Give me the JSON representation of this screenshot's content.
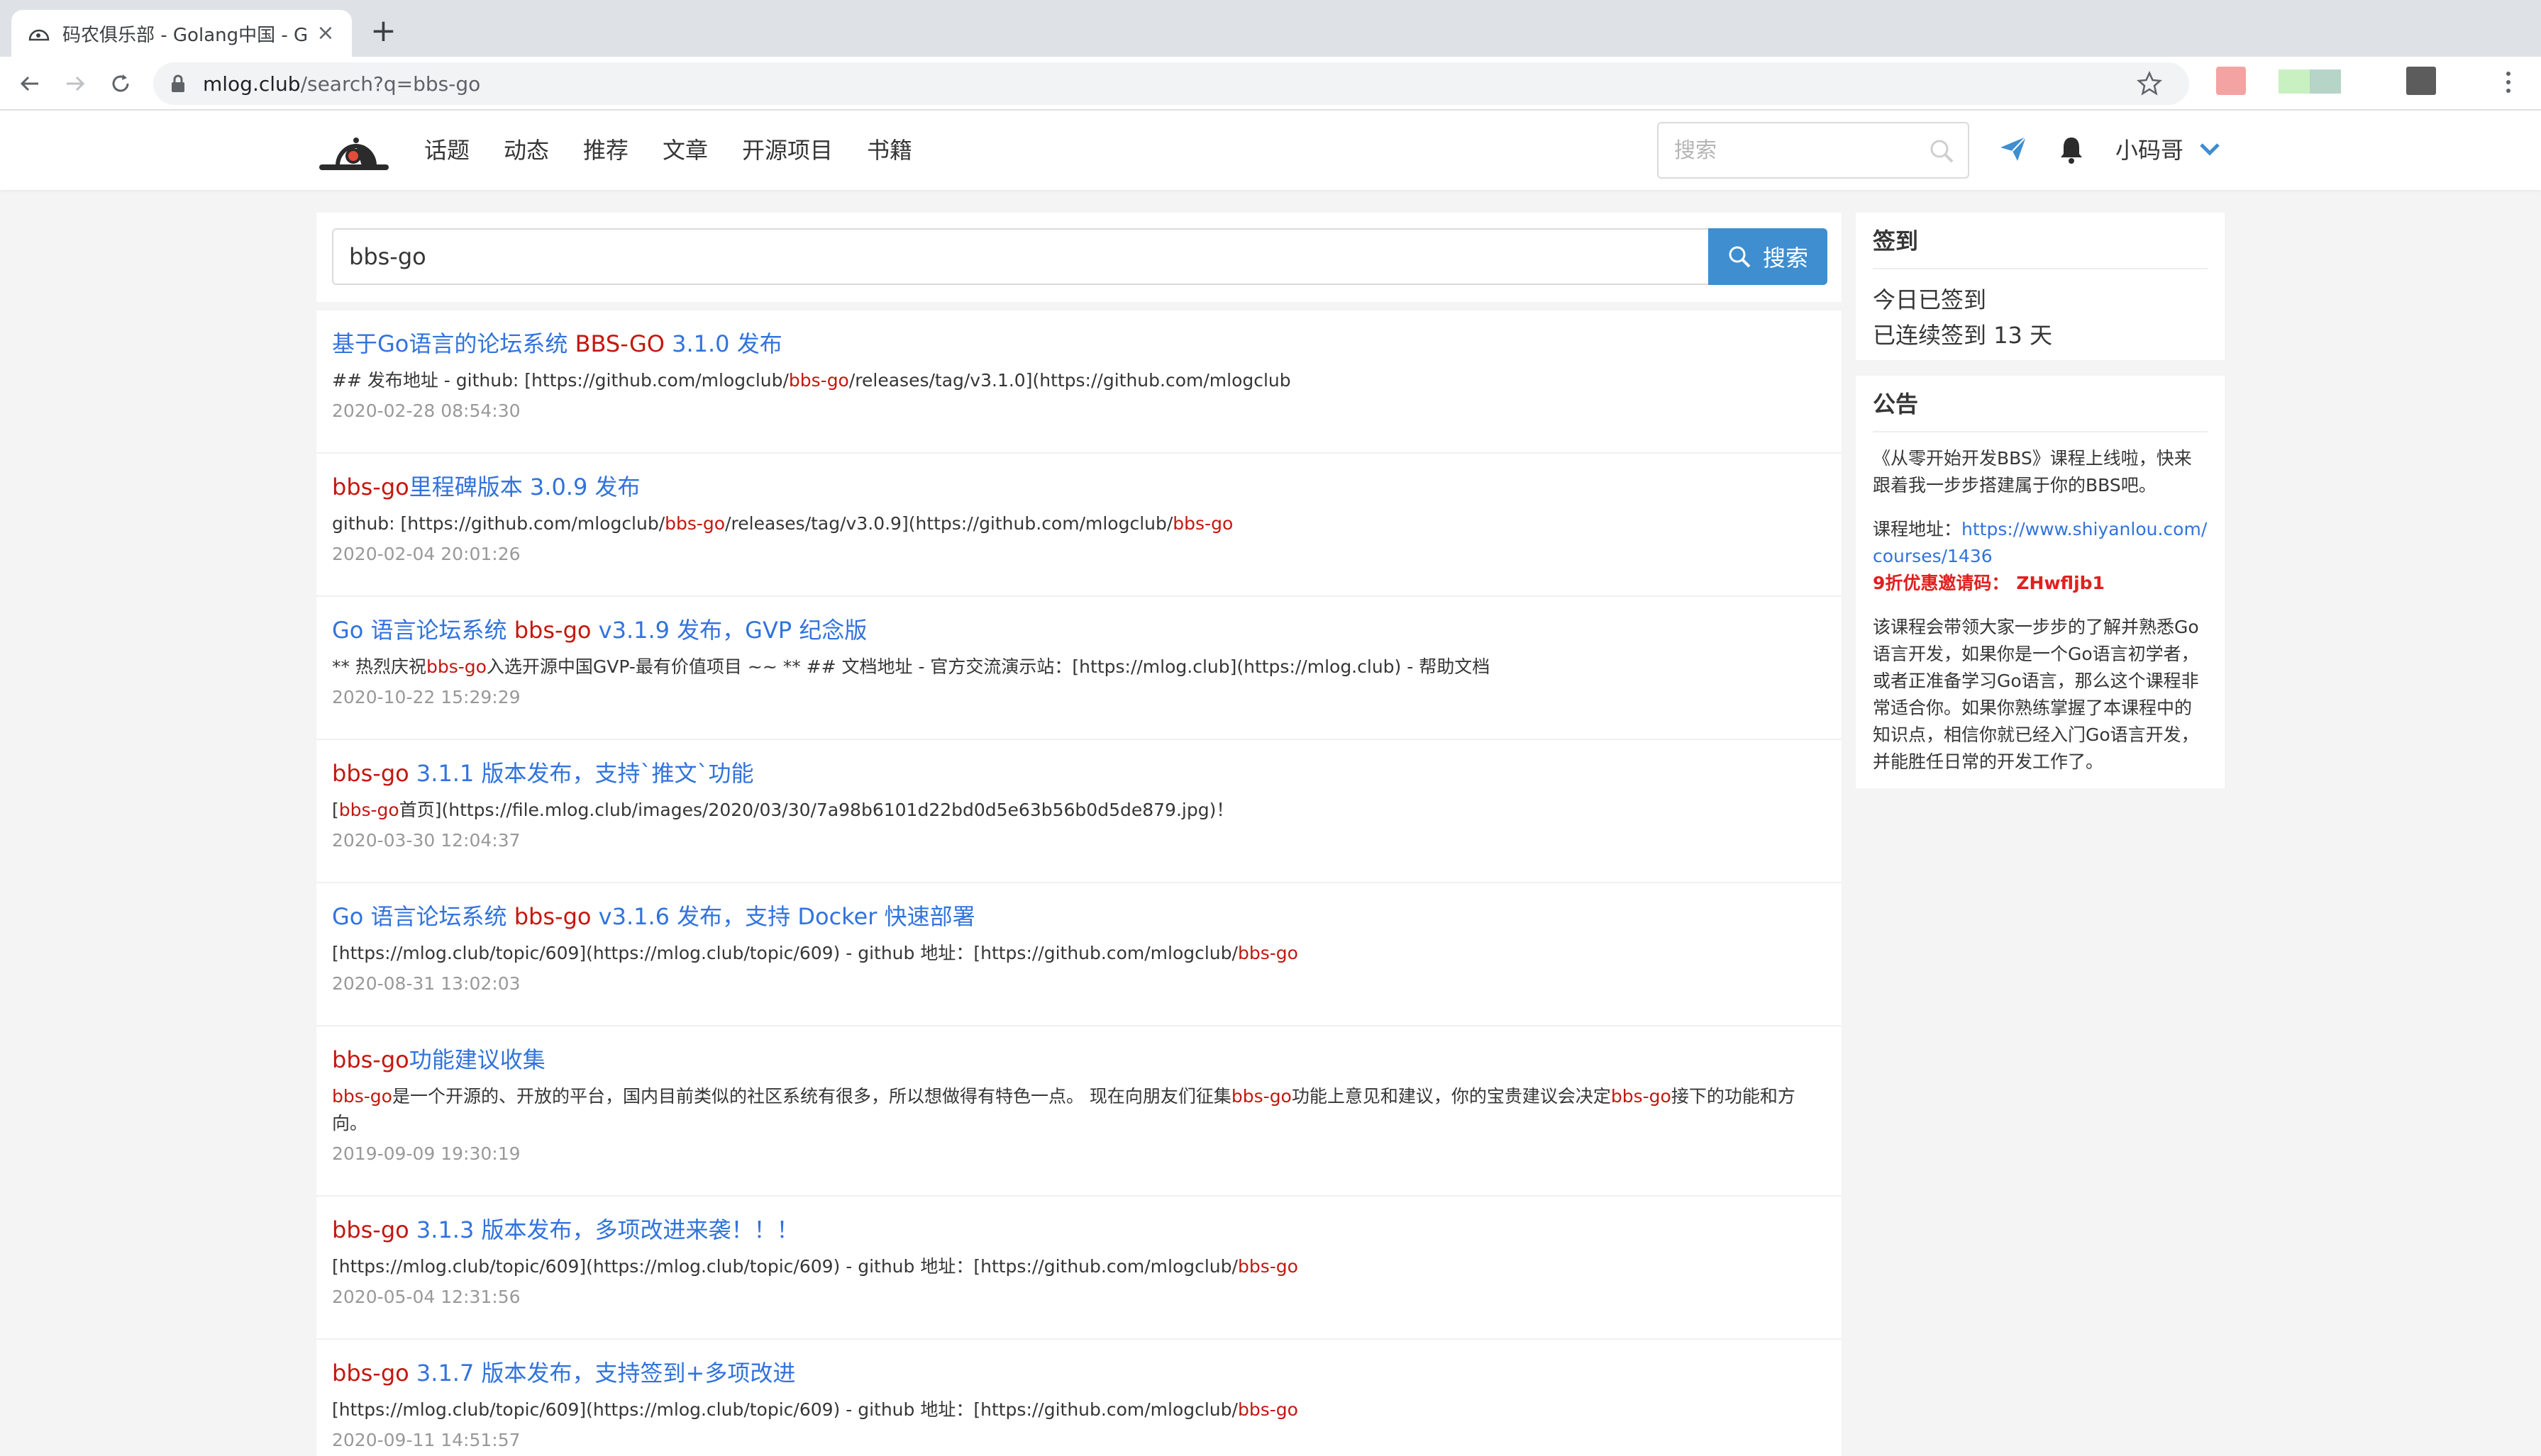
{
  "browser": {
    "tab_title": "码农俱乐部 - Golang中国 - Go语",
    "url_host": "mlog.club",
    "url_path": "/search?q=bbs-go"
  },
  "nav": {
    "items": [
      "话题",
      "动态",
      "推荐",
      "文章",
      "开源项目",
      "书籍"
    ],
    "search_placeholder": "搜索",
    "user_name": "小码哥"
  },
  "search": {
    "query": "bbs-go",
    "button_label": "搜索"
  },
  "results": [
    {
      "title": [
        {
          "t": "基于Go语言的论坛系统 "
        },
        {
          "t": "BBS-GO",
          "hl": true
        },
        {
          "t": " 3.1.0 发布"
        }
      ],
      "summary": [
        {
          "t": "## 发布地址 - github: [https://github.com/mlogclub/"
        },
        {
          "t": "bbs-go",
          "hl": true
        },
        {
          "t": "/releases/tag/v3.1.0](https://github.com/mlogclub"
        }
      ],
      "time": "2020-02-28 08:54:30"
    },
    {
      "title": [
        {
          "t": "bbs-go",
          "hl": true
        },
        {
          "t": "里程碑版本 3.0.9 发布"
        }
      ],
      "summary": [
        {
          "t": "github: [https://github.com/mlogclub/"
        },
        {
          "t": "bbs-go",
          "hl": true
        },
        {
          "t": "/releases/tag/v3.0.9](https://github.com/mlogclub/"
        },
        {
          "t": "bbs-go",
          "hl": true
        }
      ],
      "time": "2020-02-04 20:01:26"
    },
    {
      "title": [
        {
          "t": "Go 语言论坛系统 "
        },
        {
          "t": "bbs-go",
          "hl": true
        },
        {
          "t": " v3.1.9 发布，GVP 纪念版"
        }
      ],
      "summary": [
        {
          "t": "** 热烈庆祝"
        },
        {
          "t": "bbs-go",
          "hl": true
        },
        {
          "t": "入选开源中国GVP-最有价值项目 ~~ ** ## 文档地址 - 官方交流演示站：[https://mlog.club](https://mlog.club) - 帮助文档"
        }
      ],
      "time": "2020-10-22 15:29:29"
    },
    {
      "title": [
        {
          "t": "bbs-go",
          "hl": true
        },
        {
          "t": " 3.1.1 版本发布，支持`推文`功能"
        }
      ],
      "summary": [
        {
          "t": "["
        },
        {
          "t": "bbs-go",
          "hl": true
        },
        {
          "t": "首页](https://file.mlog.club/images/2020/03/30/7a98b6101d22bd0d5e63b56b0d5de879.jpg)！"
        }
      ],
      "time": "2020-03-30 12:04:37"
    },
    {
      "title": [
        {
          "t": "Go 语言论坛系统 "
        },
        {
          "t": "bbs-go",
          "hl": true
        },
        {
          "t": " v3.1.6 发布，支持 Docker 快速部署"
        }
      ],
      "summary": [
        {
          "t": "[https://mlog.club/topic/609](https://mlog.club/topic/609) - github 地址：[https://github.com/mlogclub/"
        },
        {
          "t": "bbs-go",
          "hl": true
        }
      ],
      "time": "2020-08-31 13:02:03"
    },
    {
      "title": [
        {
          "t": "bbs-go",
          "hl": true
        },
        {
          "t": "功能建议收集"
        }
      ],
      "summary": [
        {
          "t": "bbs-go",
          "hl": true
        },
        {
          "t": "是一个开源的、开放的平台，国内目前类似的社区系统有很多，所以想做得有特色一点。 现在向朋友们征集"
        },
        {
          "t": "bbs-go",
          "hl": true
        },
        {
          "t": "功能上意见和建议，你的宝贵建议会决定"
        },
        {
          "t": "bbs-go",
          "hl": true
        },
        {
          "t": "接下的功能和方向。"
        }
      ],
      "time": "2019-09-09 19:30:19"
    },
    {
      "title": [
        {
          "t": "bbs-go",
          "hl": true
        },
        {
          "t": " 3.1.3 版本发布，多项改进来袭！！！"
        }
      ],
      "summary": [
        {
          "t": "[https://mlog.club/topic/609](https://mlog.club/topic/609) - github 地址：[https://github.com/mlogclub/"
        },
        {
          "t": "bbs-go",
          "hl": true
        }
      ],
      "time": "2020-05-04 12:31:56"
    },
    {
      "title": [
        {
          "t": "bbs-go",
          "hl": true
        },
        {
          "t": " 3.1.7 版本发布，支持签到+多项改进"
        }
      ],
      "summary": [
        {
          "t": "[https://mlog.club/topic/609](https://mlog.club/topic/609) - github 地址：[https://github.com/mlogclub/"
        },
        {
          "t": "bbs-go",
          "hl": true
        }
      ],
      "time": "2020-09-11 14:51:57"
    }
  ],
  "checkin": {
    "title": "签到",
    "today": "今日已签到",
    "streak_prefix": "已连续签到 ",
    "streak_days": "13",
    "streak_suffix": " 天"
  },
  "notice": {
    "title": "公告",
    "intro": "《从零开始开发BBS》课程上线啦，快来跟着我一步步搭建属于你的BBS吧。",
    "course_label": "课程地址：",
    "course_url": "https://www.shiyanlou.com/courses/1436",
    "coupon_label": "9折优惠邀请码：",
    "coupon_code": "ZHwfljb1",
    "description": "该课程会带领大家一步步的了解并熟悉Go语言开发，如果你是一个Go语言初学者，或者正准备学习Go语言，那么这个课程非常适合你。如果你熟练掌握了本课程中的知识点，相信你就已经入门Go语言开发，并能胜任日常的开发工作了。"
  },
  "colors": {
    "link": "#3273dc",
    "highlight": "#c4170f",
    "primary_button": "#3e8ed0",
    "coupon": "#e02020"
  }
}
